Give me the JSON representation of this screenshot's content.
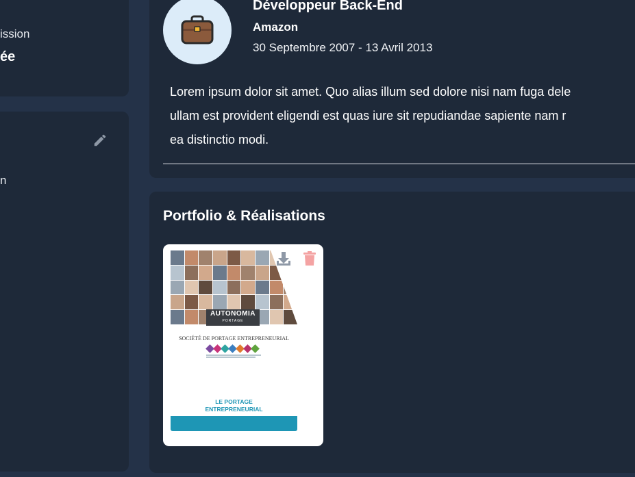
{
  "profile": {
    "left_label": "ission",
    "left_value": "ée",
    "left_fragment": "n"
  },
  "experience": {
    "title": "Développeur Back-End",
    "company": "Amazon",
    "dates": "30 Septembre 2007 - 13 Avril 2013",
    "description": [
      "Lorem ipsum dolor sit amet. Quo alias illum sed dolore nisi nam fuga dele",
      "ullam est provident eligendi est quas iure sit repudiandae sapiente nam r",
      "ea distinctio modi."
    ],
    "avatar_icon": "briefcase-icon"
  },
  "portfolio": {
    "title": "Portfolio & Réalisations",
    "items": [
      {
        "brand": "AUTONOMIA",
        "brand_sub": "PORTAGE",
        "subtitle": "SOCIÉTÉ DE PORTAGE ENTREPRENEURIAL",
        "caption_line1": "LE PORTAGE",
        "caption_line2": "ENTREPRENEURIAL"
      }
    ]
  },
  "icons": {
    "edit": "pencil-icon",
    "download": "download-icon",
    "delete": "trash-icon"
  },
  "colors": {
    "background": "#243248",
    "card": "#1e2939",
    "accent": "#1e96b5",
    "delete": "#f4a3a3",
    "download": "#8e98a6"
  }
}
